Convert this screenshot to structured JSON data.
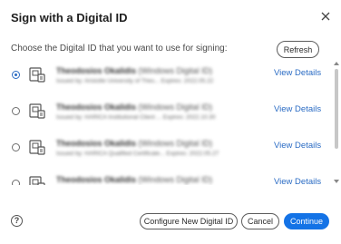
{
  "dialog": {
    "title": "Sign with a Digital ID",
    "prompt": "Choose the Digital ID that you want to use for signing:",
    "refresh_label": "Refresh"
  },
  "ids": [
    {
      "selected": true,
      "name": "Theodosios Okalidis",
      "type": "(Windows Digital ID)",
      "issuer": "Issued by: Aristotle University of Thes... Expires: 2022.05.22",
      "action": "View Details"
    },
    {
      "selected": false,
      "name": "Theodosios Okalidis",
      "type": "(Windows Digital ID)",
      "issuer": "Issued by: HARICA Institutional Client ... Expires: 2022.10.30",
      "action": "View Details"
    },
    {
      "selected": false,
      "name": "Theodosios Okalidis",
      "type": "(Windows Digital ID)",
      "issuer": "Issued by: HARICA Qualified Certificate... Expires: 2022.05.27",
      "action": "View Details"
    },
    {
      "selected": false,
      "name": "Theodosios Okalidis",
      "type": "(Windows Digital ID)",
      "issuer": "",
      "action": "View Details"
    }
  ],
  "footer": {
    "help_glyph": "?",
    "configure_label": "Configure New Digital ID",
    "cancel_label": "Cancel",
    "continue_label": "Continue"
  },
  "colors": {
    "accent": "#1473e6",
    "link": "#2b6cc4"
  }
}
